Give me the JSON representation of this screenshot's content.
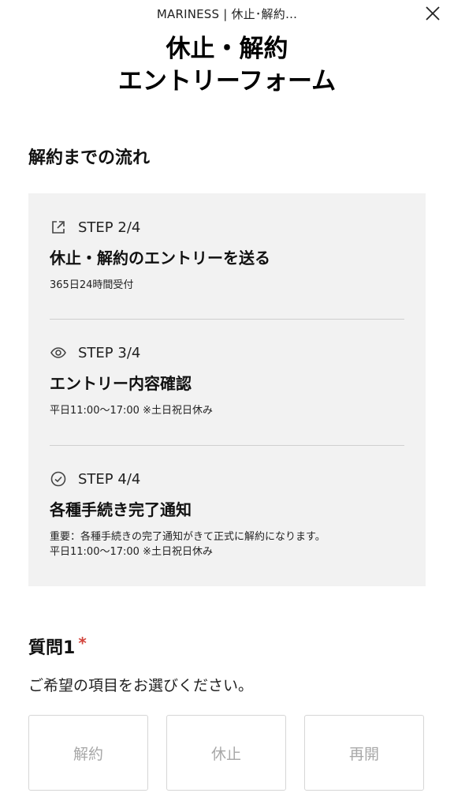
{
  "topbar": {
    "title": "MARINESS | 休止･解約…"
  },
  "heading": {
    "line1": "休止・解約",
    "line2": "エントリーフォーム"
  },
  "flow": {
    "title": "解約までの流れ",
    "steps": [
      {
        "icon": "share-out-icon",
        "label": "STEP 2/4",
        "title": "休止・解約のエントリーを送る",
        "notes": [
          "365日24時間受付"
        ]
      },
      {
        "icon": "eye-icon",
        "label": "STEP 3/4",
        "title": "エントリー内容確認",
        "notes": [
          "平日11:00〜17:00 ※土日祝日休み"
        ]
      },
      {
        "icon": "check-circle-icon",
        "label": "STEP 4/4",
        "title": "各種手続き完了通知",
        "notes": [
          "重要：各種手続きの完了通知がきて正式に解約になります。",
          "平日11:00〜17:00 ※土日祝日休み"
        ]
      }
    ]
  },
  "question1": {
    "title": "質問1",
    "required_mark": "*",
    "description": "ご希望の項目をお選びください。",
    "options": [
      "解約",
      "休止",
      "再開"
    ]
  },
  "colors": {
    "required": "#d2443c",
    "panel_bg": "#f2f2f2",
    "option_text": "#a8a8a8"
  }
}
